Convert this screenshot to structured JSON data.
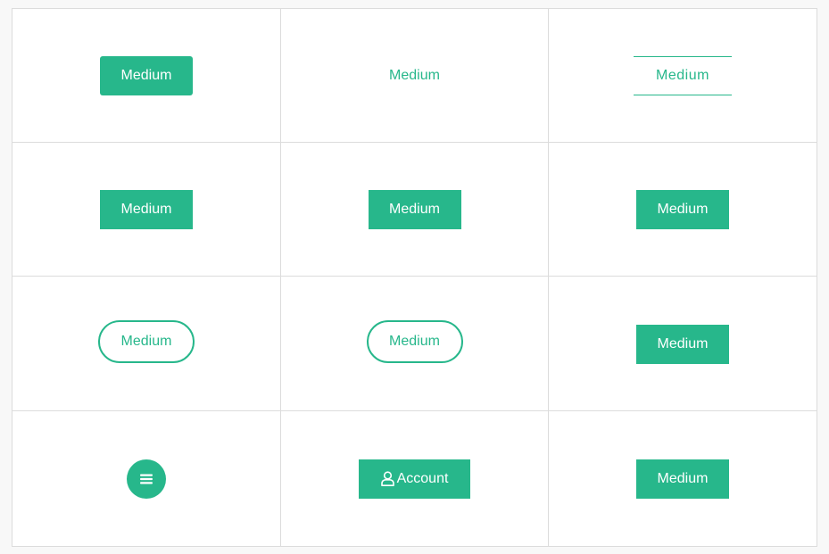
{
  "theme": {
    "accent": "#27b78b",
    "text_on_accent": "#ffffff",
    "grid_line": "#dcdcdc"
  },
  "buttons": {
    "r1c1": "Medium",
    "r1c2": "Medium",
    "r1c3": "Medium",
    "r2c1": "Medium",
    "r2c2": "Medium",
    "r2c3": "Medium",
    "r3c1": "Medium",
    "r3c2": "Medium",
    "r3c3": "Medium",
    "r4c1_icon": "hamburger-menu-icon",
    "r4c2": "Account",
    "r4c2_icon": "user-icon",
    "r4c3": "Medium"
  }
}
